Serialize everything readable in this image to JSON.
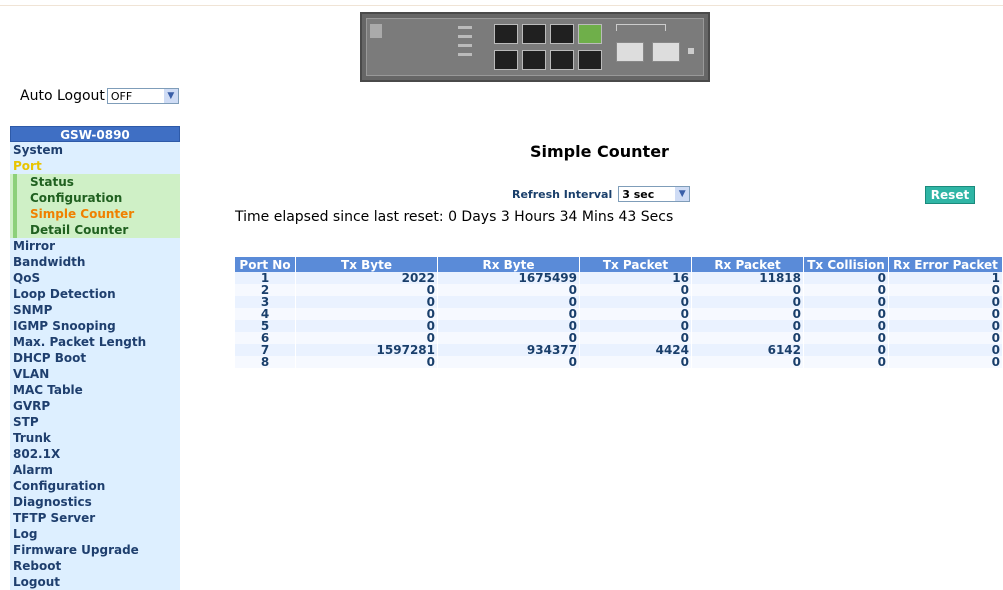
{
  "auto_logout": {
    "label": "Auto Logout",
    "value": "OFF"
  },
  "sidebar": {
    "title": "GSW-0890",
    "items": [
      {
        "label": "System"
      },
      {
        "label": "Port",
        "active": true,
        "children": [
          "Status",
          "Configuration",
          "Simple Counter",
          "Detail Counter"
        ]
      },
      {
        "label": "Mirror"
      },
      {
        "label": "Bandwidth"
      },
      {
        "label": "QoS"
      },
      {
        "label": "Loop Detection"
      },
      {
        "label": "SNMP"
      },
      {
        "label": "IGMP Snooping"
      },
      {
        "label": "Max. Packet Length"
      },
      {
        "label": "DHCP Boot"
      },
      {
        "label": "VLAN"
      },
      {
        "label": "MAC Table"
      },
      {
        "label": "GVRP"
      },
      {
        "label": "STP"
      },
      {
        "label": "Trunk"
      },
      {
        "label": "802.1X"
      },
      {
        "label": "Alarm"
      },
      {
        "label": "Configuration"
      },
      {
        "label": "Diagnostics"
      },
      {
        "label": "TFTP Server"
      },
      {
        "label": "Log"
      },
      {
        "label": "Firmware Upgrade"
      },
      {
        "label": "Reboot"
      },
      {
        "label": "Logout"
      }
    ],
    "selected_child": "Simple Counter"
  },
  "main": {
    "title": "Simple Counter",
    "refresh_label": "Refresh Interval",
    "refresh_value": "3 sec",
    "reset_label": "Reset",
    "elapsed": "Time elapsed since last reset: 0 Days 3 Hours 34 Mins 43 Secs"
  },
  "table": {
    "headers": [
      "Port No",
      "Tx Byte",
      "Rx Byte",
      "Tx Packet",
      "Rx Packet",
      "Tx Collision",
      "Rx Error Packet"
    ],
    "rows": [
      [
        "1",
        "2022",
        "1675499",
        "16",
        "11818",
        "0",
        "1"
      ],
      [
        "2",
        "0",
        "0",
        "0",
        "0",
        "0",
        "0"
      ],
      [
        "3",
        "0",
        "0",
        "0",
        "0",
        "0",
        "0"
      ],
      [
        "4",
        "0",
        "0",
        "0",
        "0",
        "0",
        "0"
      ],
      [
        "5",
        "0",
        "0",
        "0",
        "0",
        "0",
        "0"
      ],
      [
        "6",
        "0",
        "0",
        "0",
        "0",
        "0",
        "0"
      ],
      [
        "7",
        "1597281",
        "934377",
        "4424",
        "6142",
        "0",
        "0"
      ],
      [
        "8",
        "0",
        "0",
        "0",
        "0",
        "0",
        "0"
      ]
    ]
  },
  "colors": {
    "header_blue": "#5a8bd8",
    "sidebar_title": "#3f6fc4",
    "sidebar_bg": "#ddefff",
    "sub_bg": "#cff0c6",
    "selected_orange": "#f08000",
    "active_yellow": "#e8c400",
    "reset_teal": "#2fb5a5"
  }
}
